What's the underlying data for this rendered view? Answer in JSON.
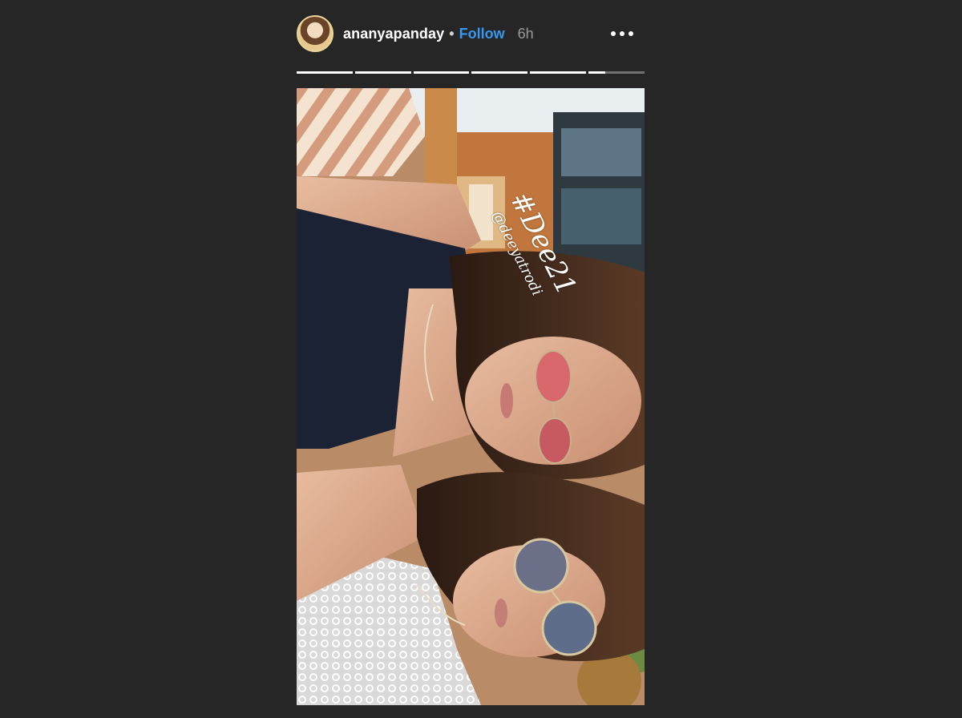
{
  "header": {
    "username": "ananyapanday",
    "separator": "•",
    "follow_label": "Follow",
    "time": "6h",
    "avatar_icon": "avatar-icon",
    "more_icon": "more-options-icon"
  },
  "progress": {
    "segments": [
      1,
      1,
      1,
      1,
      1,
      0.3
    ]
  },
  "story": {
    "hashtag": "#Dee21",
    "mention": "@deeyatrodi"
  },
  "colors": {
    "background": "#262626",
    "follow": "#3897f0",
    "text": "#ffffff"
  }
}
